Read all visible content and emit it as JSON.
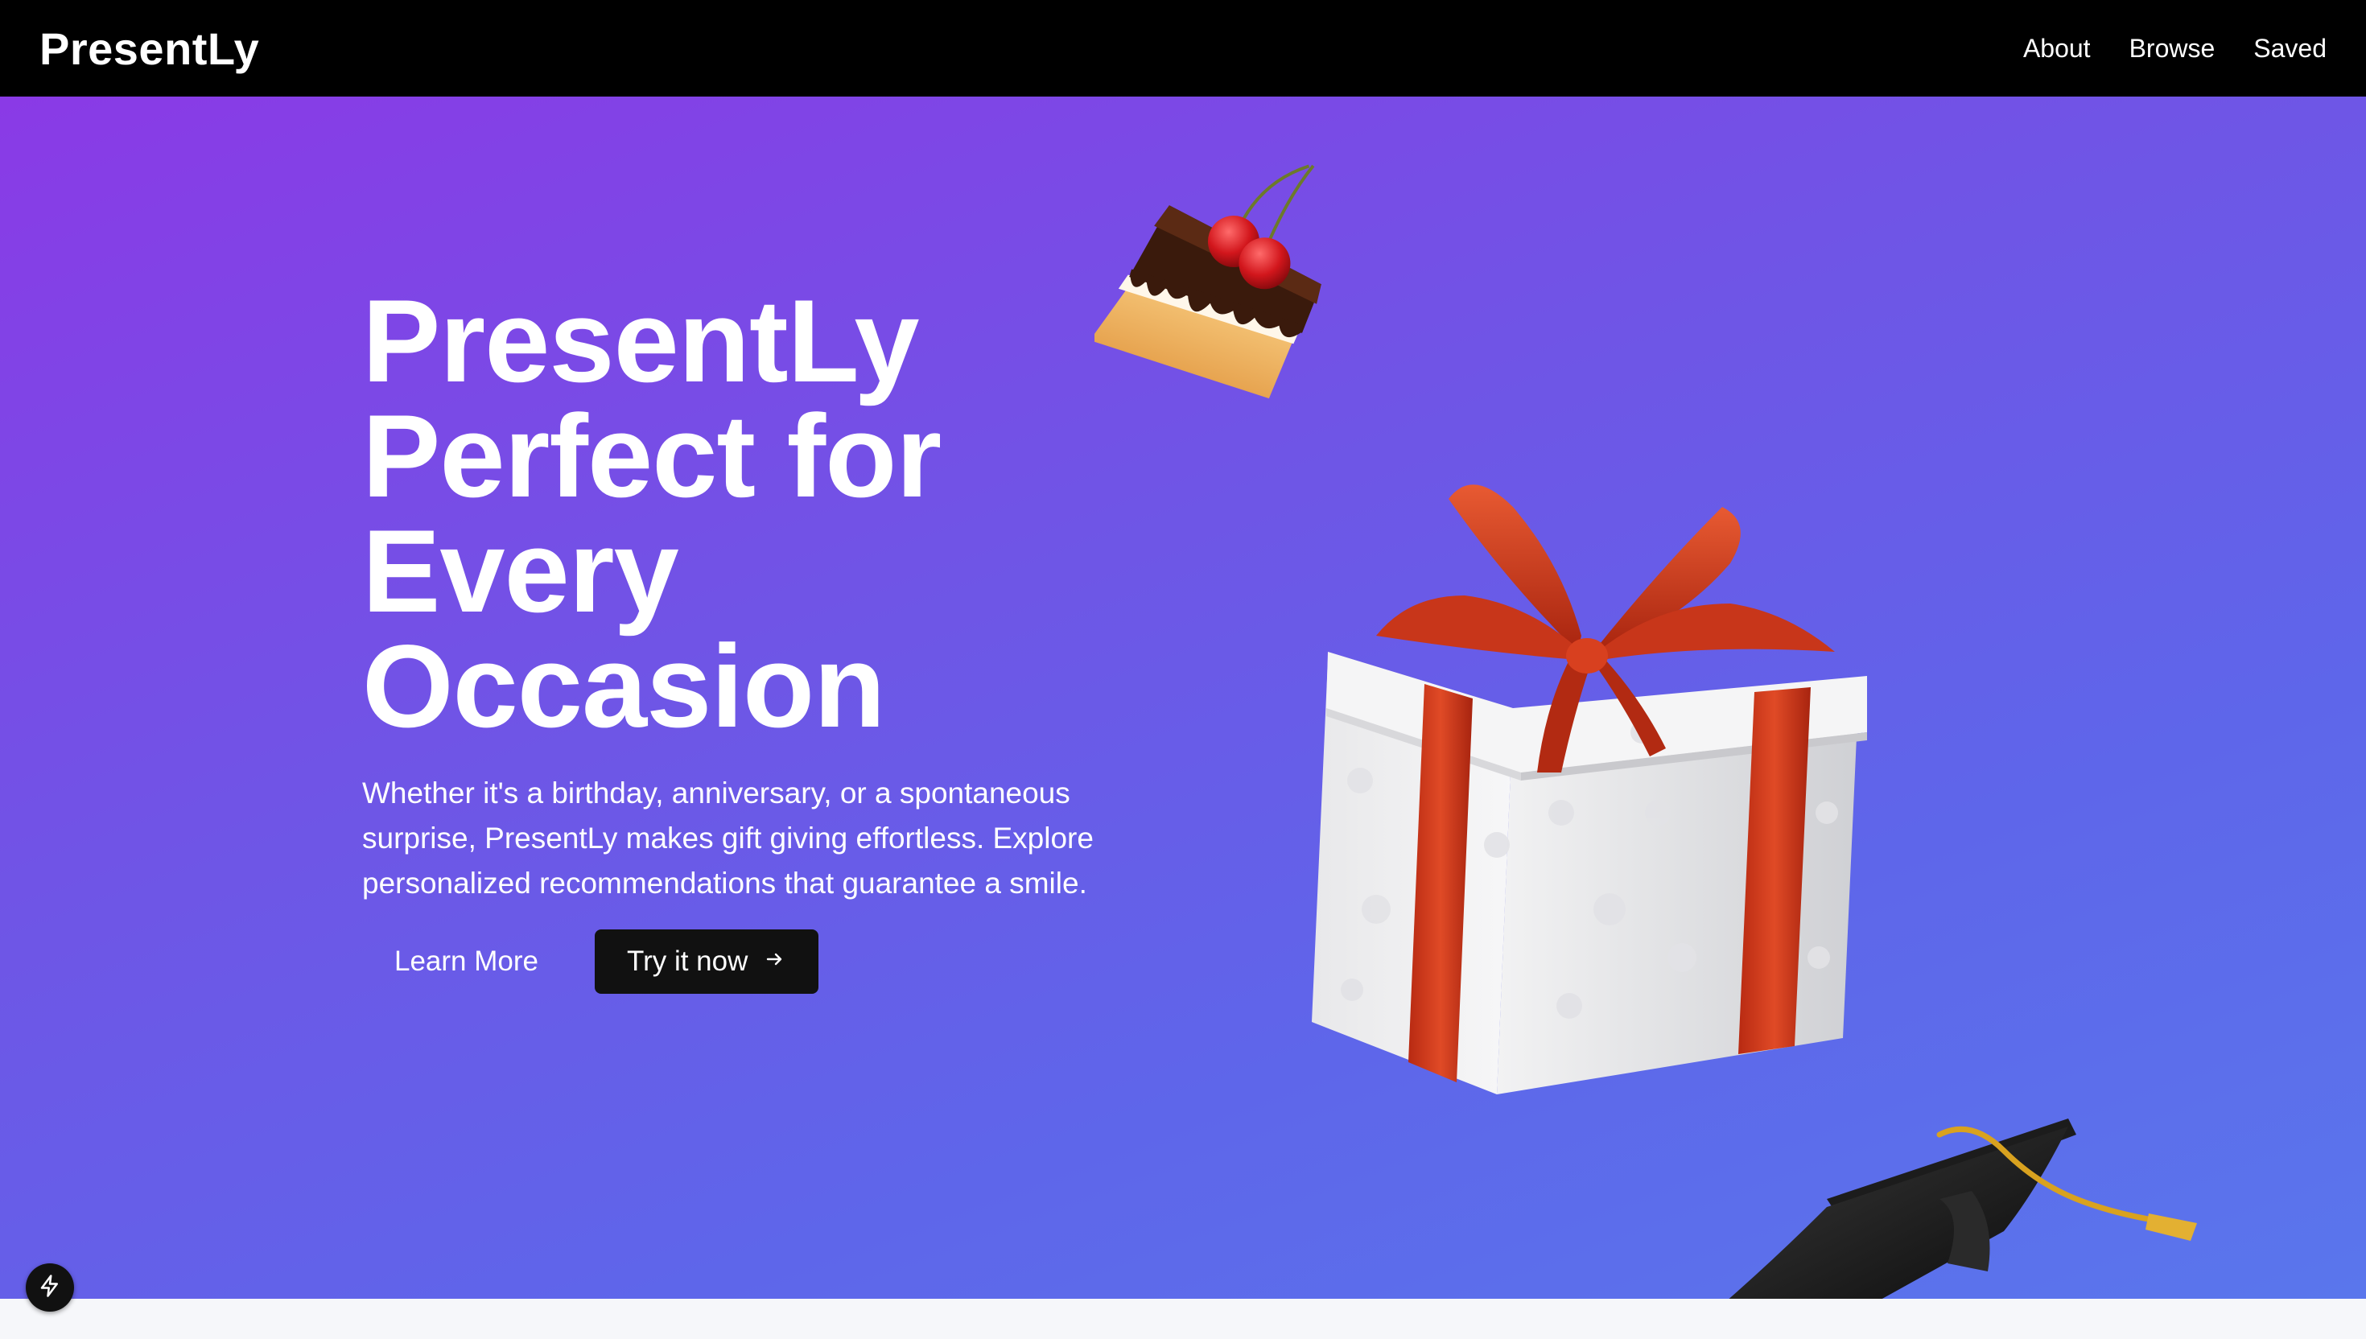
{
  "header": {
    "brand": "PresentLy",
    "nav": [
      {
        "label": "About"
      },
      {
        "label": "Browse"
      },
      {
        "label": "Saved"
      }
    ]
  },
  "hero": {
    "title_lines": [
      "PresentLy",
      "Perfect for",
      "Every",
      "Occasion"
    ],
    "description": "Whether it's a birthday, anniversary, or a spontaneous surprise, PresentLy makes gift giving effortless. Explore personalized recommendations that guarantee a smile.",
    "learn_more_label": "Learn More",
    "try_label": "Try it now",
    "try_icon": "arrow-right-icon"
  },
  "decor": {
    "items": [
      "cake-slice-illustration",
      "gift-box-illustration",
      "graduation-cap-illustration"
    ]
  },
  "dev_tools": {
    "icon": "lightning-icon"
  },
  "colors": {
    "nav_bg": "#000000",
    "hero_gradient_start": "#8a3ae6",
    "hero_gradient_end": "#5a76ec",
    "primary_button": "#111111",
    "ribbon": "#d23a1e"
  }
}
